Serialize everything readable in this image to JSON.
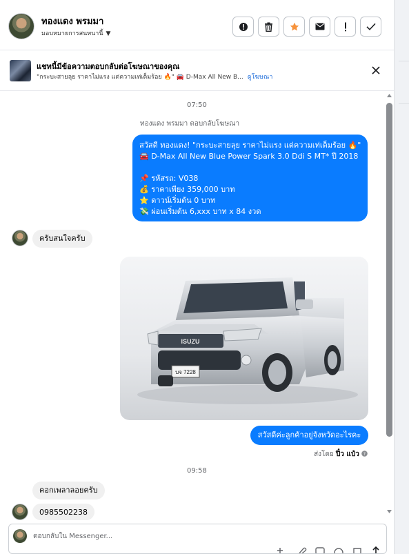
{
  "header": {
    "name": "ทองแดง พรมมา",
    "subtitle": "มอบหมายการสนทนานี้",
    "actions": [
      "report-icon",
      "trash-icon",
      "star-icon",
      "mail-icon",
      "exclamation-icon",
      "check-icon"
    ]
  },
  "ad": {
    "title": "แชทนี้มีข้อความตอบกลับต่อโฆษณาของคุณ",
    "snippet": "\"กระบะสายลุย ราคาไม่แรง แต่ความเท่เต็มร้อย 🔥\" 🚘 D-Max All New B...",
    "link": "ดูโฆษณา"
  },
  "thread": {
    "time1": "07:50",
    "system_note": "ทองแดง พรมมา ตอบกลับโฆษณา",
    "ad_message_lines": [
      "สวัสดี ทองแดง! \"กระบะสายลุย ราคาไม่แรง แต่ความเท่เต็มร้อย 🔥\"",
      "🚘 D-Max All New Blue Power Spark 3.0 Ddi S MT* ปี 2018",
      "",
      "📌 รหัสรถ: V038",
      "💰 ราคาเพียง 359,000 บาท",
      "⭐ ดาวน์เริ่มต้น 0 บาท",
      "💸 ผ่อนเริ่มต้น 6,xxx บาท x 84 งวด"
    ],
    "reply1": "ครับสนใจครับ",
    "plate_text": "บจ 7228",
    "car_badge": "ISUZU",
    "agent_message": "สวัสดีค่ะลูกค้าอยู่จังหวัดอะไรคะ",
    "sent_by_prefix": "ส่งโดย",
    "sent_by_name": "ปิ๋ว แป๋ว",
    "time2": "09:58",
    "reply2": "คอกเพลาลอยครับ",
    "reply3": "0985502238"
  },
  "composer": {
    "placeholder": "ตอบกลับใน Messenger..."
  },
  "colors": {
    "outgoing_bubble": "#0a7cff",
    "incoming_bubble": "#f0f0f0",
    "star": "#f7923b"
  }
}
